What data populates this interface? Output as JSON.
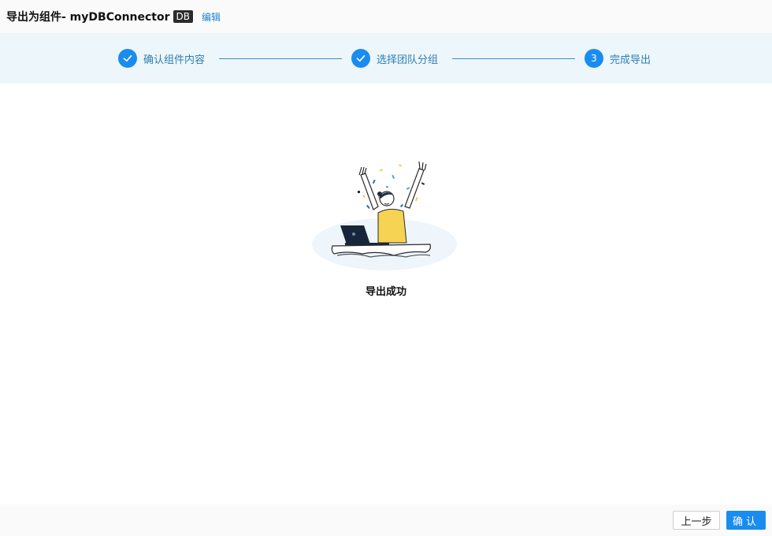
{
  "header": {
    "title": "导出为组件- myDBConnector",
    "badge": "DB",
    "edit_label": "编辑"
  },
  "steps": [
    {
      "label": "确认组件内容",
      "status": "done"
    },
    {
      "label": "选择团队分组",
      "status": "done"
    },
    {
      "label": "完成导出",
      "status": "current",
      "number": "3"
    }
  ],
  "illustration": {
    "icon": "celebration-illustration"
  },
  "result": {
    "message": "导出成功"
  },
  "footer": {
    "prev_label": "上一步",
    "confirm_label": "确认"
  },
  "colors": {
    "accent": "#1a8cf0",
    "step_label": "#2d7fb5",
    "steps_bg": "#edf6fa"
  }
}
